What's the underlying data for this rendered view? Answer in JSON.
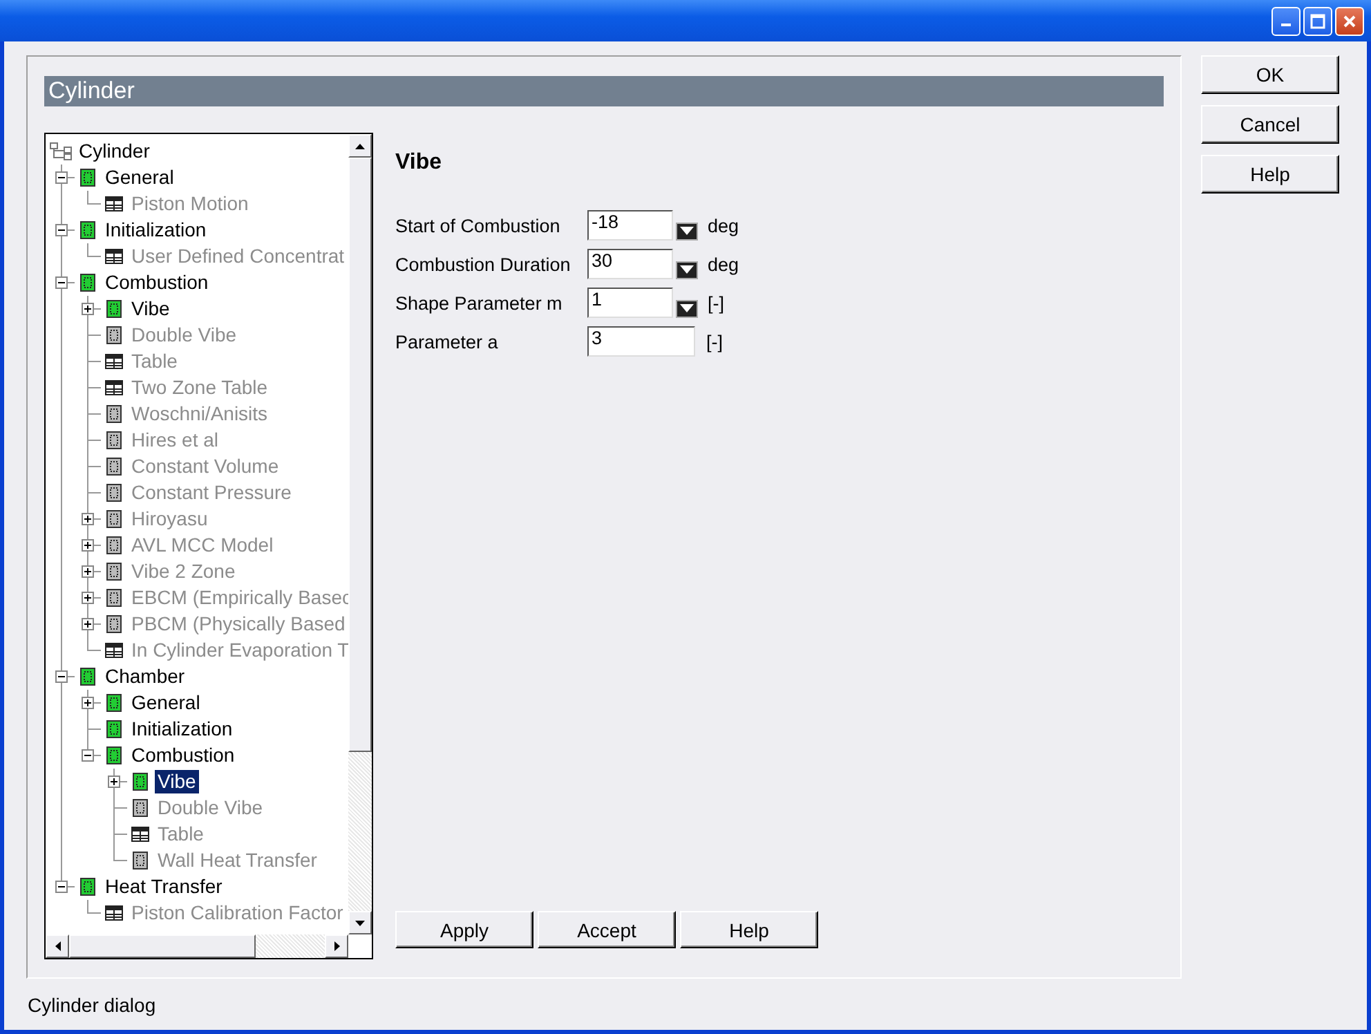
{
  "header": {
    "title": "Cylinder"
  },
  "tree": {
    "label": "Cylinder",
    "kind": "root",
    "active": true,
    "selected": false,
    "children": [
      {
        "label": "General",
        "kind": "form",
        "active": true,
        "selected": false,
        "expanded": true,
        "children": [
          {
            "label": "Piston Motion",
            "kind": "table",
            "active": false,
            "selected": false
          }
        ]
      },
      {
        "label": "Initialization",
        "kind": "form",
        "active": true,
        "selected": false,
        "expanded": true,
        "children": [
          {
            "label": "User Defined Concentrat",
            "kind": "table",
            "active": false,
            "selected": false
          }
        ]
      },
      {
        "label": "Combustion",
        "kind": "form",
        "active": true,
        "selected": false,
        "expanded": true,
        "children": [
          {
            "label": "Vibe",
            "kind": "form",
            "active": true,
            "selected": false,
            "expanded": false
          },
          {
            "label": "Double Vibe",
            "kind": "form",
            "active": false,
            "selected": false
          },
          {
            "label": "Table",
            "kind": "table",
            "active": false,
            "selected": false
          },
          {
            "label": "Two Zone Table",
            "kind": "table",
            "active": false,
            "selected": false
          },
          {
            "label": "Woschni/Anisits",
            "kind": "form",
            "active": false,
            "selected": false
          },
          {
            "label": "Hires et al",
            "kind": "form",
            "active": false,
            "selected": false
          },
          {
            "label": "Constant Volume",
            "kind": "form",
            "active": false,
            "selected": false
          },
          {
            "label": "Constant Pressure",
            "kind": "form",
            "active": false,
            "selected": false
          },
          {
            "label": "Hiroyasu",
            "kind": "form",
            "active": false,
            "selected": false,
            "expanded": false
          },
          {
            "label": "AVL MCC Model",
            "kind": "form",
            "active": false,
            "selected": false,
            "expanded": false
          },
          {
            "label": "Vibe 2 Zone",
            "kind": "form",
            "active": false,
            "selected": false,
            "expanded": false
          },
          {
            "label": "EBCM (Empirically Basec",
            "kind": "form",
            "active": false,
            "selected": false,
            "expanded": false
          },
          {
            "label": "PBCM (Physically Based",
            "kind": "form",
            "active": false,
            "selected": false,
            "expanded": false
          },
          {
            "label": "In Cylinder Evaporation T",
            "kind": "table",
            "active": false,
            "selected": false
          }
        ]
      },
      {
        "label": "Chamber",
        "kind": "form",
        "active": true,
        "selected": false,
        "expanded": true,
        "children": [
          {
            "label": "General",
            "kind": "form",
            "active": true,
            "selected": false,
            "expanded": false
          },
          {
            "label": "Initialization",
            "kind": "form",
            "active": true,
            "selected": false
          },
          {
            "label": "Combustion",
            "kind": "form",
            "active": true,
            "selected": false,
            "expanded": true,
            "children": [
              {
                "label": "Vibe",
                "kind": "form",
                "active": true,
                "selected": true,
                "expanded": false
              },
              {
                "label": "Double Vibe",
                "kind": "form",
                "active": false,
                "selected": false
              },
              {
                "label": "Table",
                "kind": "table",
                "active": false,
                "selected": false
              },
              {
                "label": "Wall Heat Transfer",
                "kind": "form",
                "active": false,
                "selected": false
              }
            ]
          }
        ]
      },
      {
        "label": "Heat Transfer",
        "kind": "form",
        "active": true,
        "selected": false,
        "expanded": true,
        "children": [
          {
            "label": "Piston Calibration Factor",
            "kind": "table",
            "active": false,
            "selected": false
          }
        ]
      }
    ]
  },
  "form": {
    "title": "Vibe",
    "fields": [
      {
        "label": "Start of Combustion",
        "value": "-18",
        "unit": "deg",
        "dropdown": true
      },
      {
        "label": "Combustion Duration",
        "value": "30",
        "unit": "deg",
        "dropdown": true
      },
      {
        "label": "Shape Parameter m",
        "value": "1",
        "unit": "[-]",
        "dropdown": true
      },
      {
        "label": "Parameter a",
        "value": "3",
        "unit": "[-]",
        "dropdown": false
      }
    ]
  },
  "bottom_buttons": [
    "Apply",
    "Accept",
    "Help"
  ],
  "side_buttons": [
    "OK",
    "Cancel",
    "Help"
  ],
  "status_bar": "Cylinder dialog"
}
